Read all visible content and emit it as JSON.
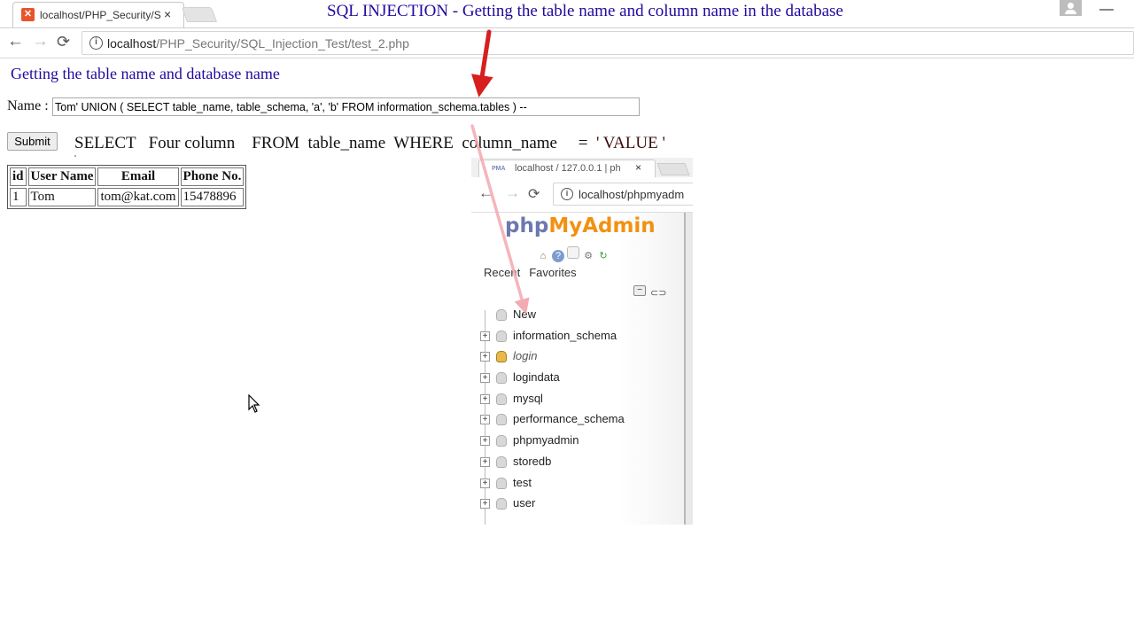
{
  "browser": {
    "tab_title": "localhost/PHP_Security/S",
    "tab_close": "×",
    "favicon": "✕",
    "url_host": "localhost",
    "url_path": "/PHP_Security/SQL_Injection_Test/test_2.php",
    "nav_back": "←",
    "nav_forward": "→",
    "nav_reload": "⟳",
    "info_icon": "i",
    "minimize": "—"
  },
  "overlay": {
    "video_title": "SQL INJECTION - Getting the table name and column name in the database",
    "title_color": "#1f0a9e",
    "arrow_color": "#e01b1b"
  },
  "page": {
    "heading": "Getting the table name and database name",
    "name_label": "Name :",
    "name_value": "Tom' UNION ( SELECT table_name, table_schema, 'a', 'b' FROM information_schema.tables ) --",
    "submit_label": "Submit",
    "sql_part1": "SELECT   Four column    FROM  table_name  WHERE  column_name     =  ",
    "sql_part2": "' VALUE '",
    "sql_tick": "'"
  },
  "table": {
    "headers": [
      "id",
      "User Name",
      "Email",
      "Phone No."
    ],
    "rows": [
      [
        "1",
        "Tom",
        "tom@kat.com",
        "15478896"
      ]
    ]
  },
  "pma": {
    "tab_favicon": "PMA",
    "tab_title": "localhost / 127.0.0.1 | ph",
    "tab_close": "×",
    "url": "localhost/phpmyadm",
    "logo_php": "php",
    "logo_myadmin": "MyAdmin",
    "recent": "Recent",
    "favorites": "Favorites",
    "icons": [
      "home-icon",
      "help-icon",
      "docs-icon",
      "settings-icon",
      "reload-icon"
    ],
    "databases": [
      {
        "name": "New",
        "expander": ""
      },
      {
        "name": "information_schema",
        "expander": "+"
      },
      {
        "name": "login",
        "expander": "+",
        "locked": true
      },
      {
        "name": "logindata",
        "expander": "+"
      },
      {
        "name": "mysql",
        "expander": "+"
      },
      {
        "name": "performance_schema",
        "expander": "+"
      },
      {
        "name": "phpmyadmin",
        "expander": "+"
      },
      {
        "name": "storedb",
        "expander": "+"
      },
      {
        "name": "test",
        "expander": "+"
      },
      {
        "name": "user",
        "expander": "+"
      }
    ]
  }
}
